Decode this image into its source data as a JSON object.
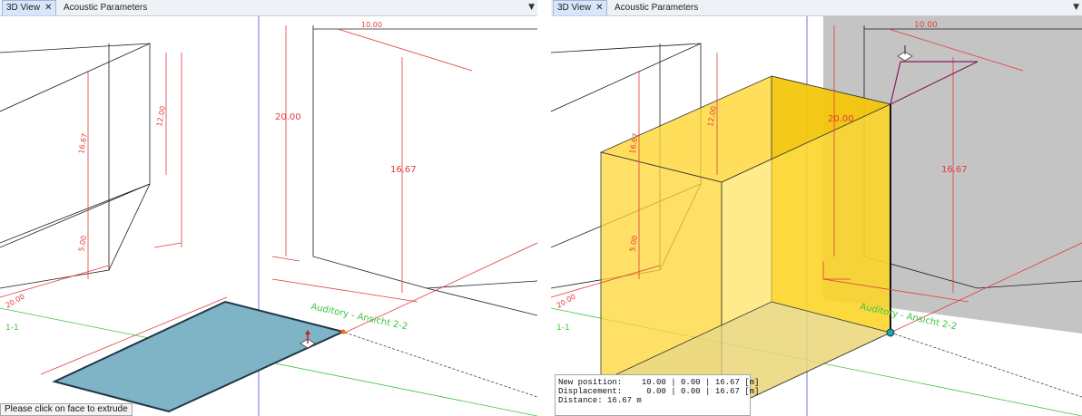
{
  "tabs": {
    "view3d": "3D View",
    "close": "✕",
    "acoustic": "Acoustic Parameters",
    "menu": "▼"
  },
  "labels": {
    "dim_20": "20.00",
    "dim_1667": "16.67",
    "dim_1200": "12.00",
    "dim_2000_small": "20.00",
    "dim_500": "5.00",
    "dim_1000": "10.00",
    "room_name": "Auditory - Ansicht 2-2",
    "grid_1": "1-1",
    "dim_2000_left": "20.00"
  },
  "status": {
    "instruction": "Please click on face to extrude"
  },
  "readout": {
    "new_position_label": "New position:",
    "new_position_value": "10.00 | 0.00 | 16.67 [m]",
    "displacement_label": "Displacement:",
    "displacement_value": " 0.00 | 0.00 | 16.67 [m]",
    "distance_label": "Distance:",
    "distance_value": "16.67 m"
  },
  "colors": {
    "face_blue": "#7fb3c6",
    "extrude_yellow": "#ffd633",
    "wall_gray": "#c4c4c4",
    "dim_red": "#e23b3b",
    "axis_green": "#3cc43c",
    "axis_blue": "#4a55d6",
    "handle_purple": "#8a1a5a"
  }
}
